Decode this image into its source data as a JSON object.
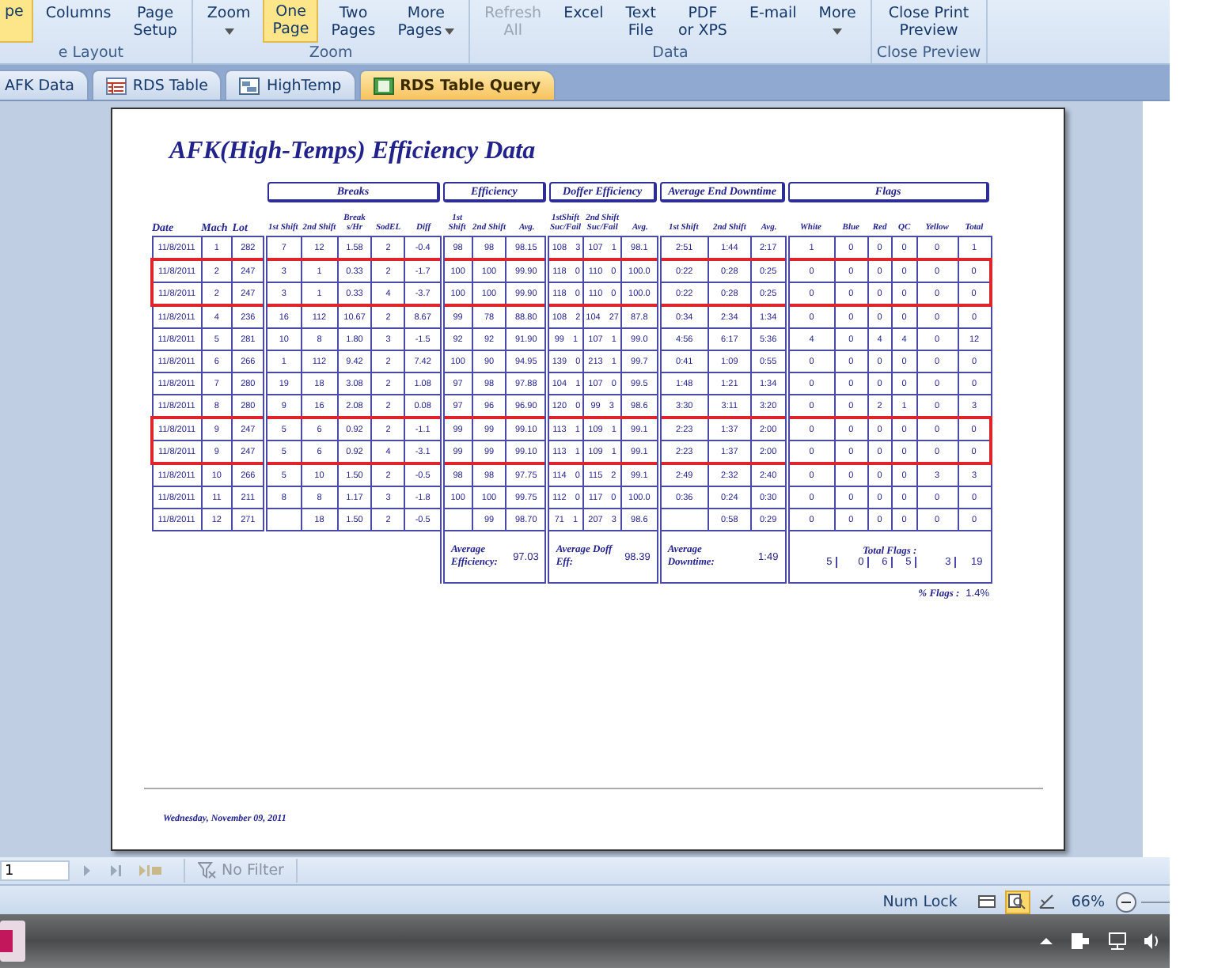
{
  "ribbon": {
    "groups": [
      {
        "label": "e Layout",
        "buttons": [
          {
            "lines": [
              "pe"
            ],
            "selected": true,
            "disabled": false,
            "dropdown": false
          },
          {
            "lines": [
              "Columns"
            ],
            "selected": false,
            "disabled": false,
            "dropdown": false
          },
          {
            "lines": [
              "Page",
              "Setup"
            ],
            "selected": false,
            "disabled": false,
            "dropdown": false
          }
        ]
      },
      {
        "label": "Zoom",
        "buttons": [
          {
            "lines": [
              "Zoom"
            ],
            "selected": false,
            "disabled": false,
            "dropdown": true
          },
          {
            "lines": [
              "One",
              "Page"
            ],
            "selected": true,
            "disabled": false,
            "dropdown": false
          },
          {
            "lines": [
              "Two",
              "Pages"
            ],
            "selected": false,
            "disabled": false,
            "dropdown": false
          },
          {
            "lines": [
              "More",
              "Pages"
            ],
            "selected": false,
            "disabled": false,
            "dropdown": true
          }
        ]
      },
      {
        "label": "Data",
        "buttons": [
          {
            "lines": [
              "Refresh",
              "All"
            ],
            "selected": false,
            "disabled": true,
            "dropdown": false
          },
          {
            "lines": [
              "Excel"
            ],
            "selected": false,
            "disabled": false,
            "dropdown": false
          },
          {
            "lines": [
              "Text",
              "File"
            ],
            "selected": false,
            "disabled": false,
            "dropdown": false
          },
          {
            "lines": [
              "PDF",
              "or XPS"
            ],
            "selected": false,
            "disabled": false,
            "dropdown": false
          },
          {
            "lines": [
              "E-mail"
            ],
            "selected": false,
            "disabled": false,
            "dropdown": false
          },
          {
            "lines": [
              "More"
            ],
            "selected": false,
            "disabled": false,
            "dropdown": true
          }
        ]
      },
      {
        "label": "Close Preview",
        "buttons": [
          {
            "lines": [
              "Close Print",
              "Preview"
            ],
            "selected": false,
            "disabled": false,
            "dropdown": false
          }
        ]
      }
    ]
  },
  "tabs": [
    {
      "label": "AFK Data",
      "kind": "plain",
      "selected": false
    },
    {
      "label": "RDS Table",
      "kind": "table",
      "selected": false
    },
    {
      "label": "HighTemp",
      "kind": "form",
      "selected": false
    },
    {
      "label": "RDS Table Query",
      "kind": "report",
      "selected": true
    }
  ],
  "report": {
    "title": "AFK(High-Temps) Efficiency Data",
    "group_headers": [
      "Breaks",
      "Efficiency",
      "Doffer Efficiency",
      "Average End Downtime",
      "Flags"
    ],
    "columns": [
      "Date",
      "Mach",
      "Lot",
      "1st Shift",
      "2nd Shift",
      "Break s/Hr",
      "SodEL",
      "Diff",
      "1st Shift",
      "2nd Shift",
      "Avg.",
      "1stShift Suc/Fail",
      "2nd Shift Suc/Fail",
      "Avg.",
      "1st Shift",
      "2nd Shift",
      "Avg.",
      "White",
      "Blue",
      "Red",
      "QC",
      "Yellow",
      "Total"
    ],
    "rows": [
      {
        "marked": false,
        "cells": [
          "11/8/2011",
          "1",
          "282",
          "7",
          "12",
          "1.58",
          "2",
          "-0.4",
          "98",
          "98",
          "98.15",
          "108 3",
          "107 1",
          "98.1",
          "2:51",
          "1:44",
          "2:17",
          "1",
          "0",
          "0",
          "0",
          "0",
          "1"
        ]
      },
      {
        "marked": true,
        "cells": [
          "11/8/2011",
          "2",
          "247",
          "3",
          "1",
          "0.33",
          "2",
          "-1.7",
          "100",
          "100",
          "99.90",
          "118 0",
          "110 0",
          "100.0",
          "0:22",
          "0:28",
          "0:25",
          "0",
          "0",
          "0",
          "0",
          "0",
          "0"
        ]
      },
      {
        "marked": true,
        "cells": [
          "11/8/2011",
          "2",
          "247",
          "3",
          "1",
          "0.33",
          "4",
          "-3.7",
          "100",
          "100",
          "99.90",
          "118 0",
          "110 0",
          "100.0",
          "0:22",
          "0:28",
          "0:25",
          "0",
          "0",
          "0",
          "0",
          "0",
          "0"
        ]
      },
      {
        "marked": false,
        "cells": [
          "11/8/2011",
          "4",
          "236",
          "16",
          "112",
          "10.67",
          "2",
          "8.67",
          "99",
          "78",
          "88.80",
          "108 2",
          "104 27",
          "87.8",
          "0:34",
          "2:34",
          "1:34",
          "0",
          "0",
          "0",
          "0",
          "0",
          "0"
        ]
      },
      {
        "marked": false,
        "cells": [
          "11/8/2011",
          "5",
          "281",
          "10",
          "8",
          "1.80",
          "3",
          "-1.5",
          "92",
          "92",
          "91.90",
          "99 1",
          "107 1",
          "99.0",
          "4:56",
          "6:17",
          "5:36",
          "4",
          "0",
          "4",
          "4",
          "0",
          "12"
        ]
      },
      {
        "marked": false,
        "cells": [
          "11/8/2011",
          "6",
          "266",
          "1",
          "112",
          "9.42",
          "2",
          "7.42",
          "100",
          "90",
          "94.95",
          "139 0",
          "213 1",
          "99.7",
          "0:41",
          "1:09",
          "0:55",
          "0",
          "0",
          "0",
          "0",
          "0",
          "0"
        ]
      },
      {
        "marked": false,
        "cells": [
          "11/8/2011",
          "7",
          "280",
          "19",
          "18",
          "3.08",
          "2",
          "1.08",
          "97",
          "98",
          "97.88",
          "104 1",
          "107 0",
          "99.5",
          "1:48",
          "1:21",
          "1:34",
          "0",
          "0",
          "0",
          "0",
          "0",
          "0"
        ]
      },
      {
        "marked": false,
        "cells": [
          "11/8/2011",
          "8",
          "280",
          "9",
          "16",
          "2.08",
          "2",
          "0.08",
          "97",
          "96",
          "96.90",
          "120 0",
          "99 3",
          "98.6",
          "3:30",
          "3:11",
          "3:20",
          "0",
          "0",
          "2",
          "1",
          "0",
          "3"
        ]
      },
      {
        "marked": true,
        "cells": [
          "11/8/2011",
          "9",
          "247",
          "5",
          "6",
          "0.92",
          "2",
          "-1.1",
          "99",
          "99",
          "99.10",
          "113 1",
          "109 1",
          "99.1",
          "2:23",
          "1:37",
          "2:00",
          "0",
          "0",
          "0",
          "0",
          "0",
          "0"
        ]
      },
      {
        "marked": true,
        "cells": [
          "11/8/2011",
          "9",
          "247",
          "5",
          "6",
          "0.92",
          "4",
          "-3.1",
          "99",
          "99",
          "99.10",
          "113 1",
          "109 1",
          "99.1",
          "2:23",
          "1:37",
          "2:00",
          "0",
          "0",
          "0",
          "0",
          "0",
          "0"
        ]
      },
      {
        "marked": false,
        "cells": [
          "11/8/2011",
          "10",
          "266",
          "5",
          "10",
          "1.50",
          "2",
          "-0.5",
          "98",
          "98",
          "97.75",
          "114 0",
          "115 2",
          "99.1",
          "2:49",
          "2:32",
          "2:40",
          "0",
          "0",
          "0",
          "0",
          "3",
          "3"
        ]
      },
      {
        "marked": false,
        "cells": [
          "11/8/2011",
          "11",
          "211",
          "8",
          "8",
          "1.17",
          "3",
          "-1.8",
          "100",
          "100",
          "99.75",
          "112 0",
          "117 0",
          "100.0",
          "0:36",
          "0:24",
          "0:30",
          "0",
          "0",
          "0",
          "0",
          "0",
          "0"
        ]
      },
      {
        "marked": false,
        "cells": [
          "11/8/2011",
          "12",
          "271",
          null,
          "18",
          "1.50",
          "2",
          "-0.5",
          null,
          "99",
          "98.70",
          "71 1",
          "207 3",
          "98.6",
          null,
          "0:58",
          "0:29",
          "0",
          "0",
          "0",
          "0",
          "0",
          "0"
        ]
      }
    ],
    "summary": {
      "efficiency_label": "Average Efficiency:",
      "efficiency_value": "97.03",
      "doff_label": "Average Doff Eff:",
      "doff_value": "98.39",
      "downtime_label": "Average Downtime:",
      "downtime_value": "1:49",
      "flags_label": "Total Flags :",
      "flag_totals": [
        "5",
        "0",
        "6",
        "5",
        "3",
        "19"
      ],
      "percent_label": "% Flags :",
      "percent_value": "1.4%"
    },
    "footer_date": "Wednesday, November 09, 2011"
  },
  "record_nav": {
    "value": "1",
    "filter": "No Filter"
  },
  "status_bar": {
    "text": "Num Lock",
    "views": [
      {
        "selected": false
      },
      {
        "selected": true
      },
      {
        "selected": false
      }
    ],
    "zoom": "66%"
  }
}
